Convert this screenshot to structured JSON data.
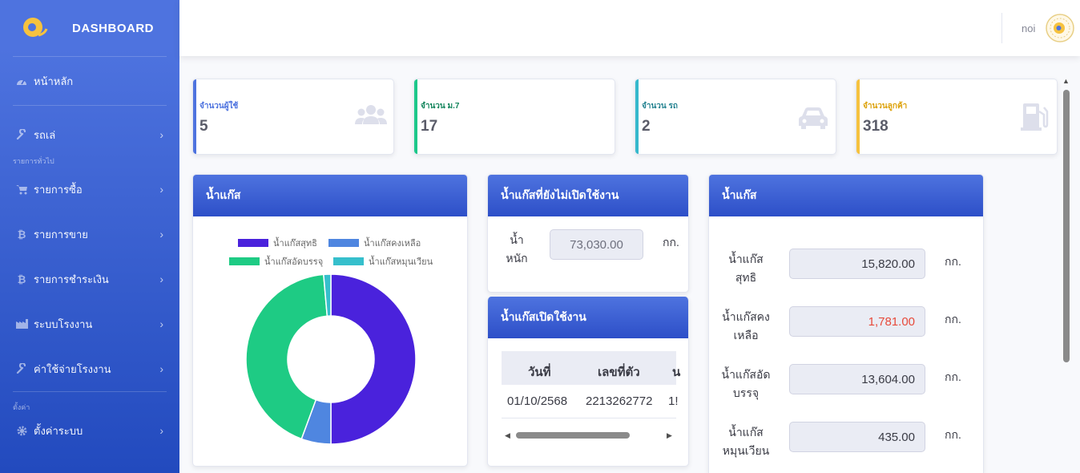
{
  "brand": {
    "title": "DASHBOARD"
  },
  "sidebar": {
    "home": "หน้าหลัก",
    "section_general": "รายการทั่วไป",
    "section_settings": "ตั้งค่า",
    "items": [
      {
        "label": "รถเล่",
        "icon": "wrench-icon"
      },
      {
        "label": "รายการซื้อ",
        "icon": "cart-icon"
      },
      {
        "label": "รายการขาย",
        "icon": "bitcoin-icon"
      },
      {
        "label": "รายการชำระเงิน",
        "icon": "bitcoin-icon"
      },
      {
        "label": "ระบบโรงงาน",
        "icon": "industry-icon"
      },
      {
        "label": "ค่าใช้จ่ายโรงงาน",
        "icon": "wrench-icon"
      },
      {
        "label": "ตั้งค่าระบบ",
        "icon": "gear-icon"
      }
    ]
  },
  "topbar": {
    "user_name": "noi"
  },
  "stats": [
    {
      "label": "จำนวนผู้ใช้",
      "value": "5",
      "color": "#4e73df",
      "icon": "users-icon"
    },
    {
      "label": "จำนวน ม.7",
      "value": "17",
      "color": "#1cc88a",
      "icon": "none"
    },
    {
      "label": "จำนวน รถ",
      "value": "2",
      "color": "#36b9cc",
      "icon": "car-icon"
    },
    {
      "label": "จำนวนลูกค้า",
      "value": "318",
      "color": "#f6c23e",
      "icon": "gas-pump-icon"
    }
  ],
  "panel_chart": {
    "title": "น้ำแก๊ส",
    "legend": [
      "น้ำแก๊สสุทธิ",
      "น้ำแก๊สคงเหลือ",
      "น้ำแก๊สอัดบรรจุ",
      "น้ำแก๊สหมุนเวียน"
    ]
  },
  "chart_data": {
    "type": "pie",
    "variant": "doughnut",
    "categories": [
      "น้ำแก๊สสุทธิ",
      "น้ำแก๊สคงเหลือ",
      "น้ำแก๊สอัดบรรจุ",
      "น้ำแก๊สหมุนเวียน"
    ],
    "values": [
      15820,
      1781,
      13604,
      435
    ],
    "colors": [
      "#4a22dc",
      "#4f86e0",
      "#1ecb84",
      "#36bfcc"
    ],
    "legend_position": "top"
  },
  "panel_unopened": {
    "title": "น้ำแก๊สที่ยังไม่เปิดใช้งาน",
    "label": "น้ำหนัก",
    "value": "73,030.00",
    "unit": "กก."
  },
  "panel_opened": {
    "title": "น้ำแก๊สเปิดใช้งาน",
    "columns": [
      "วันที่",
      "เลขที่ตัว",
      "น"
    ],
    "rows": [
      [
        "01/10/2568",
        "2213262772",
        "1!"
      ]
    ]
  },
  "panel_summary": {
    "title": "น้ำแก๊ส",
    "rows": [
      {
        "label": "น้ำแก๊สสุทธิ",
        "value": "15,820.00",
        "unit": "กก.",
        "color": "#3a3b45"
      },
      {
        "label": "น้ำแก๊สคงเหลือ",
        "value": "1,781.00",
        "unit": "กก.",
        "color": "#e74a3b"
      },
      {
        "label": "น้ำแก๊สอัดบรรจุ",
        "value": "13,604.00",
        "unit": "กก.",
        "color": "#3a3b45"
      },
      {
        "label": "น้ำแก๊สหมุนเวียน",
        "value": "435.00",
        "unit": "กก.",
        "color": "#3a3b45"
      }
    ]
  }
}
